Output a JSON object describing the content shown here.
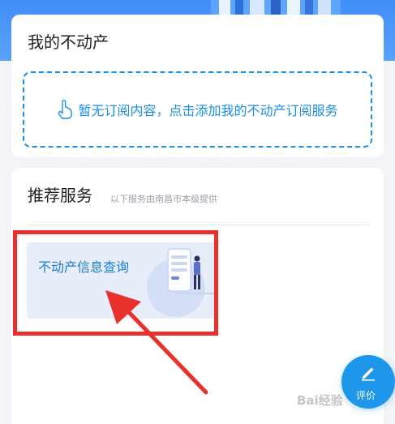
{
  "my_property": {
    "title": "我的不动产",
    "subscribe_prompt": "暂无订阅内容，点击添加我的不动产订阅服务"
  },
  "recommended": {
    "title": "推荐服务",
    "note": "以下服务由南昌市本级提供",
    "services": [
      {
        "label": "不动产信息查询"
      }
    ]
  },
  "fab": {
    "label": "评价",
    "icon": "pencil-icon"
  },
  "watermark": "Bai经验",
  "colors": {
    "accent": "#1a8fe8",
    "highlight": "#e8302c",
    "banner": "#3f8ef7",
    "fab": "#1e96ea"
  }
}
